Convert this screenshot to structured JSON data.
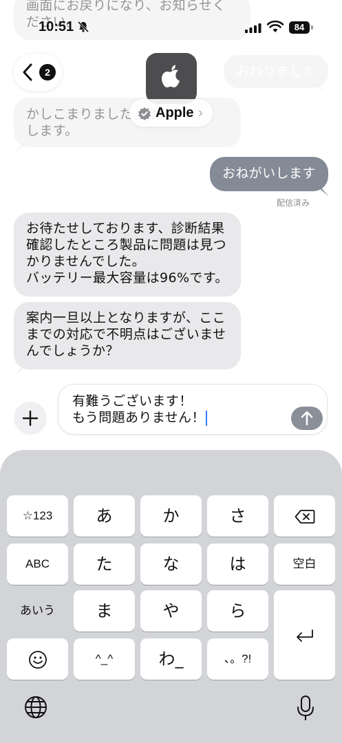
{
  "status_bar": {
    "time": "10:51",
    "battery": "84"
  },
  "header": {
    "back_badge": "2",
    "contact_name": "Apple",
    "contact_chevron": "›"
  },
  "messages": [
    {
      "id": "m1",
      "lines": [
        "画面にお戻りになり、お知らせく",
        "ださい。"
      ]
    },
    {
      "id": "m2",
      "text": "おわりました"
    },
    {
      "id": "m3",
      "lines": [
        "かしこまりました。確認",
        "します。"
      ]
    },
    {
      "id": "m4",
      "text": "おねがいします"
    },
    {
      "id": "m5",
      "lines": [
        "お待たせしております、診断結果",
        "確認したところ製品に問題は見つ",
        "かりませんでした。",
        "バッテリー最大容量は96%です。"
      ]
    },
    {
      "id": "m6",
      "lines": [
        "案内一旦以上となりますが、ここ",
        "までの対応で不明点はございませ",
        "んでしょうか？"
      ]
    }
  ],
  "delivered_label": "配信済み",
  "input": {
    "lines": [
      "有難うございます！",
      "もう問題ありません！"
    ]
  },
  "keyboard": {
    "rows": [
      [
        "☆123",
        "あ",
        "か",
        "さ",
        "⌫"
      ],
      [
        "ABC",
        "た",
        "な",
        "は",
        "空白"
      ],
      [
        "あいう",
        "ま",
        "や",
        "ら",
        "↵"
      ],
      [
        "☺",
        "^_^",
        "わ_",
        "、。?!"
      ]
    ]
  },
  "colors": {
    "incoming_bubble": "#e9e9eb",
    "outgoing_bubble": "#848a96",
    "keyboard_bg": "#d3d4d8"
  }
}
